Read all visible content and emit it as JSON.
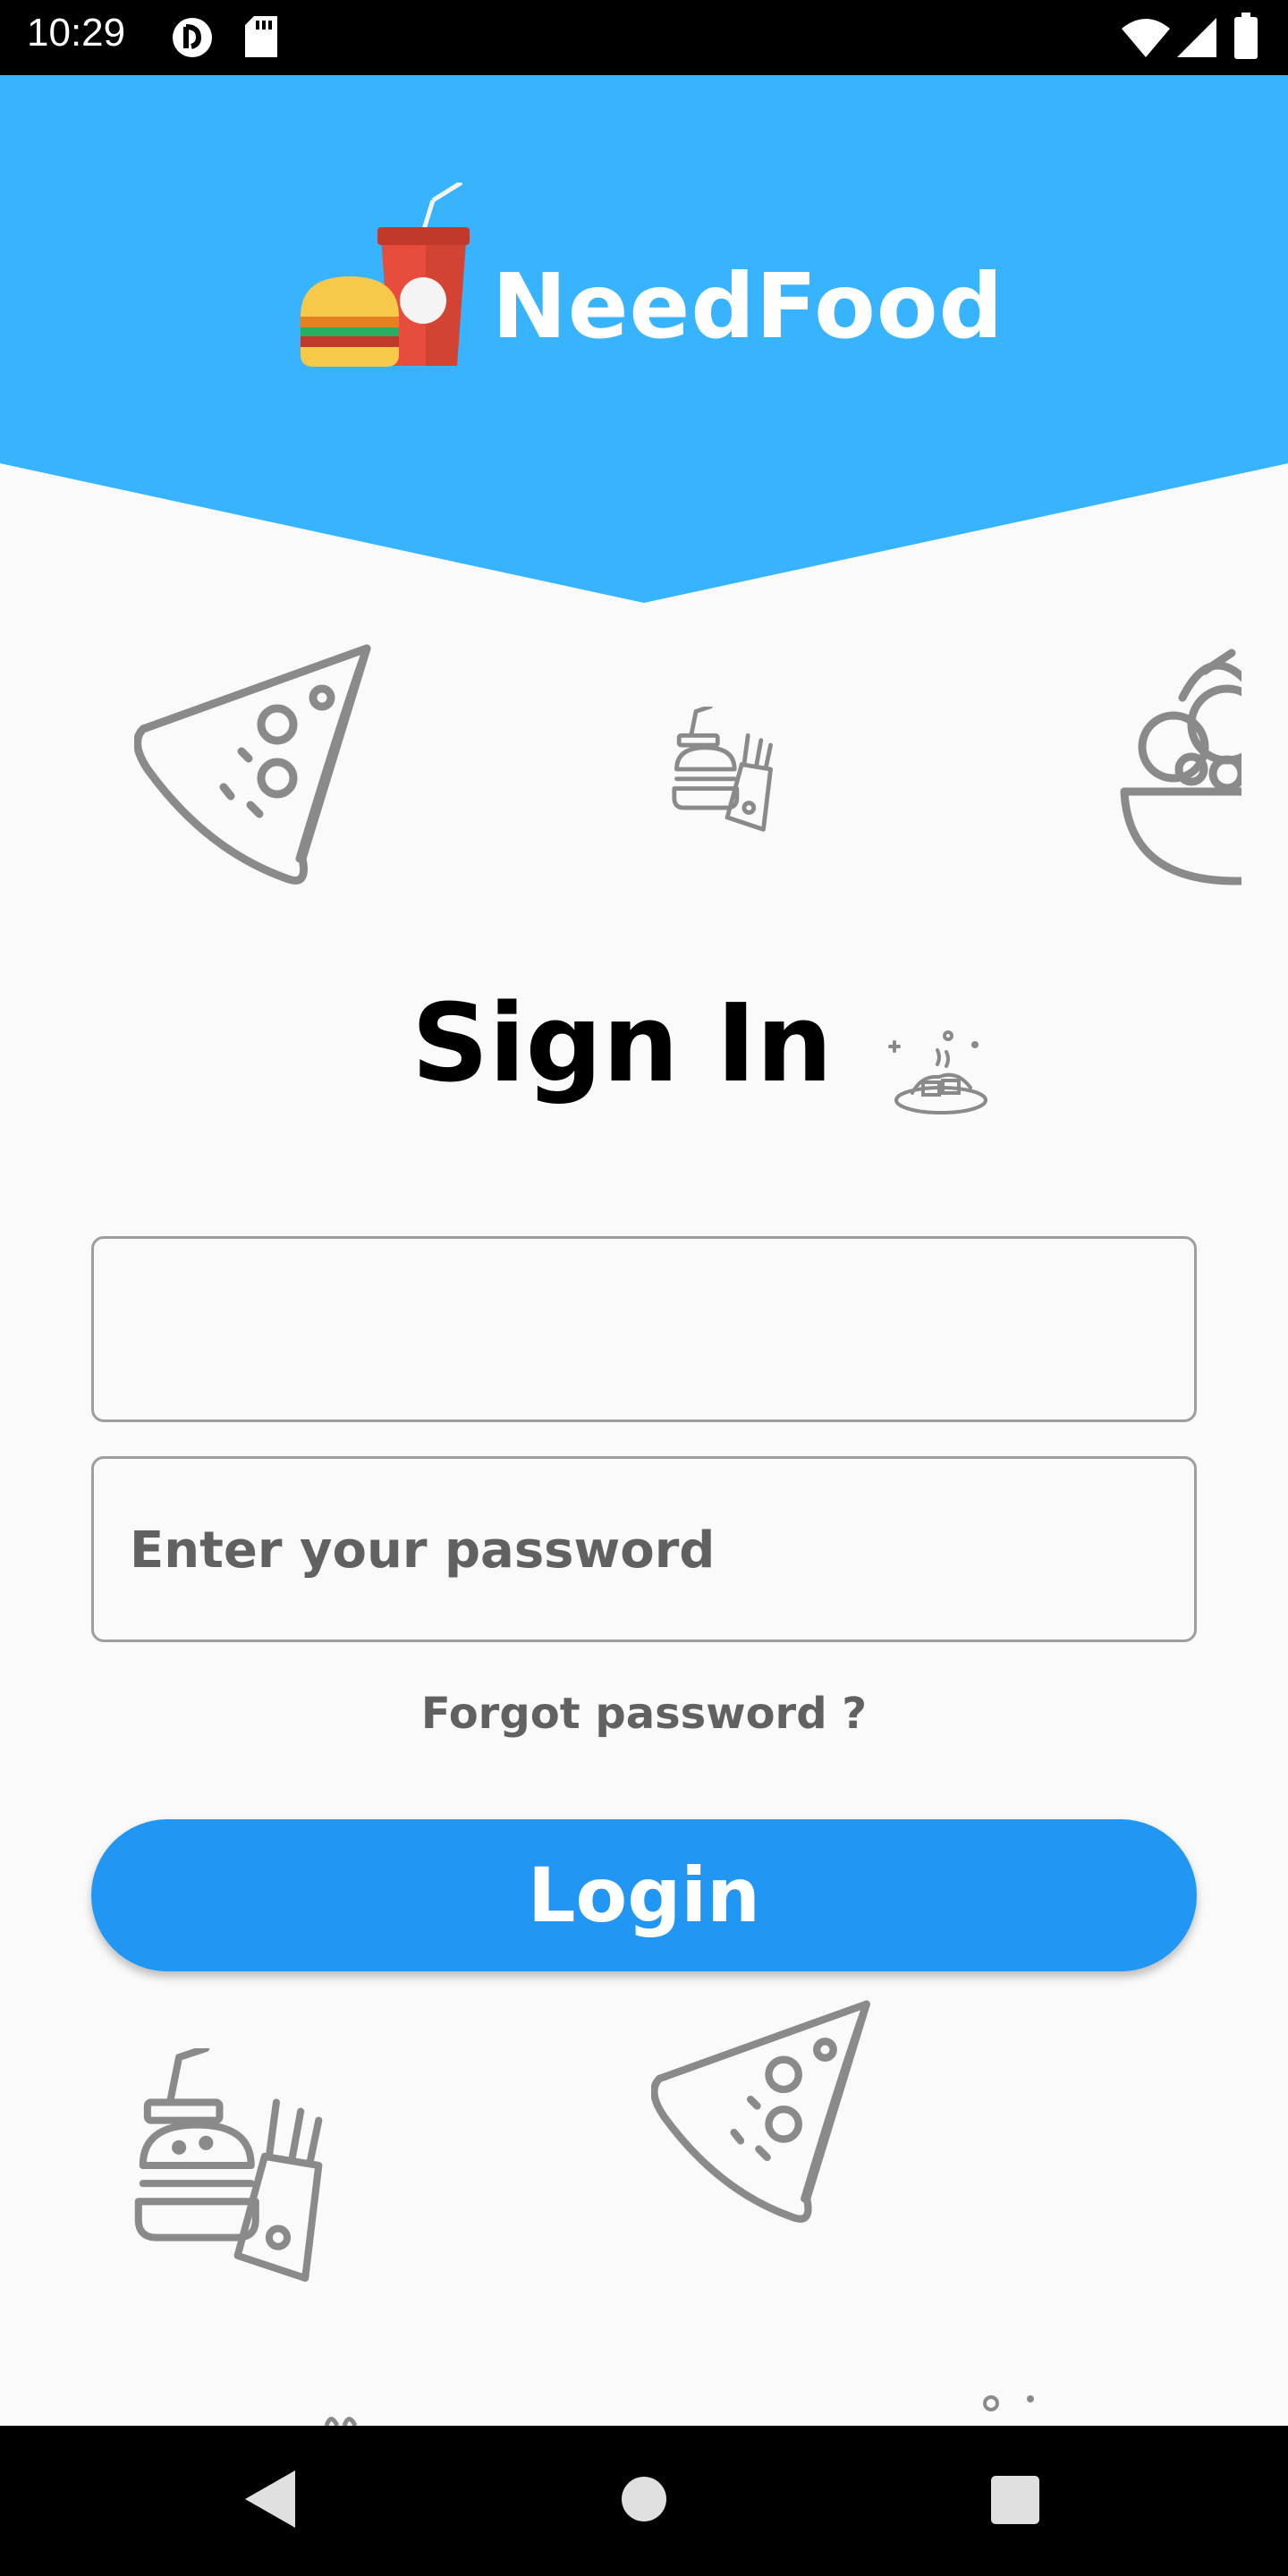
{
  "status_bar": {
    "time": "10:29",
    "icons": [
      "tracking-icon",
      "sd-card-icon",
      "wifi-icon",
      "cellular-icon",
      "battery-icon"
    ]
  },
  "header": {
    "app_name": "NeedFood",
    "background_color": "#38b4fe",
    "logo_icon": "burger-and-drink-logo"
  },
  "decorations": [
    "pizza-slice-icon",
    "burger-fries-icon",
    "salad-bowl-icon",
    "dish-icon",
    "burger-fries-icon",
    "pizza-slice-icon"
  ],
  "signin": {
    "title": "Sign In",
    "email_value": "",
    "password_placeholder": "Enter your password",
    "forgot_password": "Forgot password ?",
    "login_label": "Login",
    "accent_color": "#2196f3"
  },
  "nav_bar": {
    "buttons": [
      "back-icon",
      "home-icon",
      "recents-icon"
    ]
  }
}
